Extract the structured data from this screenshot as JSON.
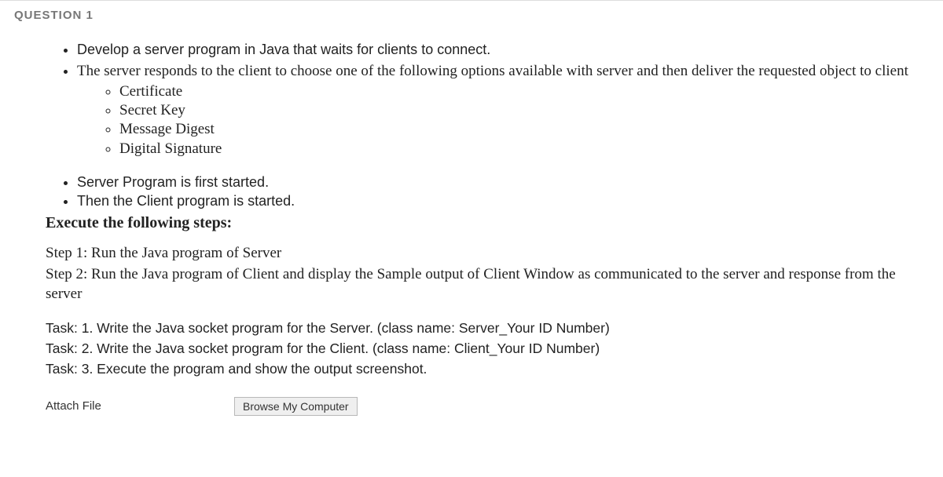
{
  "header": {
    "title": "QUESTION 1"
  },
  "intro": {
    "items": [
      "Develop a server program in Java that waits for clients to connect.",
      "The server responds to the client to choose one of the following options available with server and then deliver the requested object to client"
    ],
    "sub": [
      "Certificate",
      "Secret Key",
      "Message Digest",
      "Digital Signature"
    ]
  },
  "seq": {
    "items": [
      "Server Program is first started.",
      "Then the Client program is started."
    ]
  },
  "exec_heading": "Execute the following steps:",
  "steps": {
    "s1": "Step 1: Run the Java program of Server",
    "s2": "Step 2: Run the Java program of Client and display the Sample output of Client Window as communicated to the server and response from the server"
  },
  "tasks": {
    "t1": "Task: 1. Write the Java socket program for the Server. (class name: Server_Your ID Number)",
    "t2": "Task: 2. Write the Java socket program for the Client. (class name: Client_Your ID Number)",
    "t3": "Task: 3.  Execute the program and show the output screenshot."
  },
  "attach": {
    "label": "Attach File",
    "button": "Browse My Computer"
  }
}
